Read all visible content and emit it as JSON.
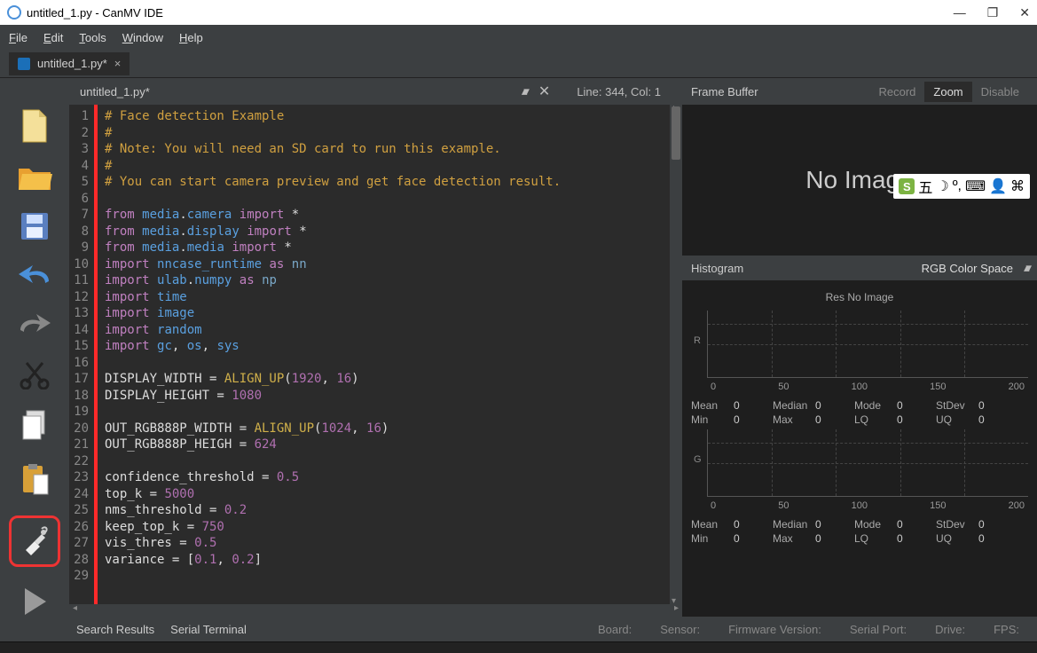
{
  "window": {
    "title": "untitled_1.py - CanMV IDE"
  },
  "menu": {
    "file": "File",
    "edit": "Edit",
    "tools": "Tools",
    "window": "Window",
    "help": "Help"
  },
  "tab": {
    "label": "untitled_1.py*"
  },
  "editor": {
    "filename": "untitled_1.py*",
    "linecol": "Line: 344, Col: 1",
    "lines": [
      {
        "n": 1,
        "t": "# Face detection Example",
        "cls": "c-comment"
      },
      {
        "n": 2,
        "t": "#",
        "cls": "c-comment"
      },
      {
        "n": 3,
        "t": "# Note: You will need an SD card to run this example.",
        "cls": "c-comment"
      },
      {
        "n": 4,
        "t": "#",
        "cls": "c-comment"
      },
      {
        "n": 5,
        "t": "# You can start camera preview and get face detection result.",
        "cls": "c-comment"
      },
      {
        "n": 6,
        "t": "",
        "cls": ""
      },
      {
        "n": 7,
        "html": "<span class='c-kw'>from</span> <span class='c-mod'>media</span>.<span class='c-mod'>camera</span> <span class='c-kw'>import</span> *"
      },
      {
        "n": 8,
        "html": "<span class='c-kw'>from</span> <span class='c-mod'>media</span>.<span class='c-mod'>display</span> <span class='c-kw'>import</span> *"
      },
      {
        "n": 9,
        "html": "<span class='c-kw'>from</span> <span class='c-mod'>media</span>.<span class='c-mod'>media</span> <span class='c-kw'>import</span> *"
      },
      {
        "n": 10,
        "html": "<span class='c-kw'>import</span> <span class='c-mod'>nncase_runtime</span> <span class='c-kw'>as</span> <span class='c-name'>nn</span>"
      },
      {
        "n": 11,
        "html": "<span class='c-kw'>import</span> <span class='c-mod'>ulab</span>.<span class='c-mod'>numpy</span> <span class='c-kw'>as</span> <span class='c-name'>np</span>"
      },
      {
        "n": 12,
        "html": "<span class='c-kw'>import</span> <span class='c-mod'>time</span>"
      },
      {
        "n": 13,
        "html": "<span class='c-kw'>import</span> <span class='c-mod'>image</span>"
      },
      {
        "n": 14,
        "html": "<span class='c-kw'>import</span> <span class='c-mod'>random</span>"
      },
      {
        "n": 15,
        "html": "<span class='c-kw'>import</span> <span class='c-mod'>gc</span>, <span class='c-mod'>os</span>, <span class='c-mod'>sys</span>"
      },
      {
        "n": 16,
        "t": "",
        "cls": ""
      },
      {
        "n": 17,
        "html": "DISPLAY_WIDTH = <span class='c-func'>ALIGN_UP</span>(<span class='c-num'>1920</span>, <span class='c-num'>16</span>)"
      },
      {
        "n": 18,
        "html": "DISPLAY_HEIGHT = <span class='c-num'>1080</span>"
      },
      {
        "n": 19,
        "t": "",
        "cls": ""
      },
      {
        "n": 20,
        "html": "OUT_RGB888P_WIDTH = <span class='c-func'>ALIGN_UP</span>(<span class='c-num'>1024</span>, <span class='c-num'>16</span>)"
      },
      {
        "n": 21,
        "html": "OUT_RGB888P_HEIGH = <span class='c-num'>624</span>"
      },
      {
        "n": 22,
        "t": "",
        "cls": ""
      },
      {
        "n": 23,
        "html": "confidence_threshold = <span class='c-num'>0.5</span>"
      },
      {
        "n": 24,
        "html": "top_k = <span class='c-num'>5000</span>"
      },
      {
        "n": 25,
        "html": "nms_threshold = <span class='c-num'>0.2</span>"
      },
      {
        "n": 26,
        "html": "keep_top_k = <span class='c-num'>750</span>"
      },
      {
        "n": 27,
        "html": "vis_thres = <span class='c-num'>0.5</span>"
      },
      {
        "n": 28,
        "html": "variance = [<span class='c-num'>0.1</span>, <span class='c-num'>0.2</span>]"
      },
      {
        "n": 29,
        "t": "",
        "cls": ""
      }
    ]
  },
  "framebuffer": {
    "title": "Frame Buffer",
    "record": "Record",
    "zoom": "Zoom",
    "disable": "Disable",
    "placeholder": "No Image"
  },
  "ime": [
    "五",
    "",
    "",
    "",
    ""
  ],
  "histogram": {
    "title": "Histogram",
    "colorspace": "RGB Color Space",
    "res": "Res   No Image",
    "ticks": [
      "0",
      "50",
      "100",
      "150",
      "200"
    ],
    "channels": [
      {
        "label": "R",
        "stats": [
          {
            "l": "Mean",
            "v": "0"
          },
          {
            "l": "Median",
            "v": "0"
          },
          {
            "l": "Mode",
            "v": "0"
          },
          {
            "l": "StDev",
            "v": "0"
          },
          {
            "l": "Min",
            "v": "0"
          },
          {
            "l": "Max",
            "v": "0"
          },
          {
            "l": "LQ",
            "v": "0"
          },
          {
            "l": "UQ",
            "v": "0"
          }
        ]
      },
      {
        "label": "G",
        "stats": [
          {
            "l": "Mean",
            "v": "0"
          },
          {
            "l": "Median",
            "v": "0"
          },
          {
            "l": "Mode",
            "v": "0"
          },
          {
            "l": "StDev",
            "v": "0"
          },
          {
            "l": "Min",
            "v": "0"
          },
          {
            "l": "Max",
            "v": "0"
          },
          {
            "l": "LQ",
            "v": "0"
          },
          {
            "l": "UQ",
            "v": "0"
          }
        ]
      }
    ]
  },
  "statusbar": {
    "search": "Search Results",
    "terminal": "Serial Terminal",
    "board": "Board:",
    "sensor": "Sensor:",
    "fw": "Firmware Version:",
    "port": "Serial Port:",
    "drive": "Drive:",
    "fps": "FPS:"
  },
  "chart_data": {
    "type": "bar",
    "title": "Histogram",
    "xlabel": "",
    "ylabel": "",
    "categories": [
      0,
      50,
      100,
      150,
      200
    ],
    "series": [
      {
        "name": "R",
        "values": [
          0,
          0,
          0,
          0,
          0
        ]
      },
      {
        "name": "G",
        "values": [
          0,
          0,
          0,
          0,
          0
        ]
      }
    ],
    "ylim": [
      0,
      0
    ],
    "note": "No Image — empty histogram"
  }
}
